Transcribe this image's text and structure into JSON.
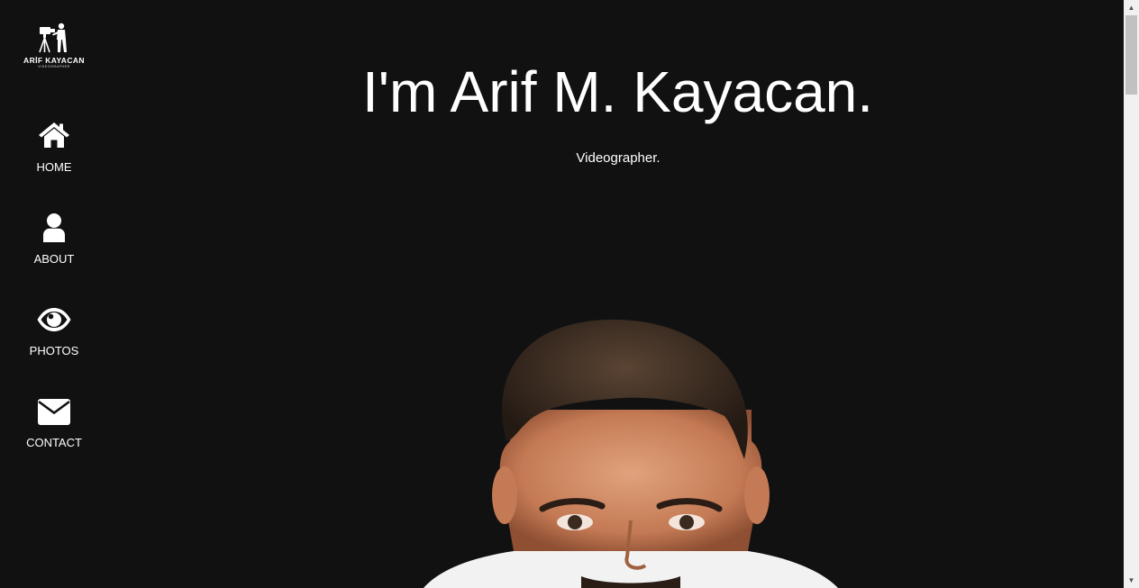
{
  "brand": {
    "name": "ARİF KAYACAN",
    "tagline": "VIDEOGRAPHER"
  },
  "nav": [
    {
      "label": "HOME",
      "icon": "home-icon"
    },
    {
      "label": "ABOUT",
      "icon": "user-icon"
    },
    {
      "label": "PHOTOS",
      "icon": "eye-icon"
    },
    {
      "label": "CONTACT",
      "icon": "envelope-icon"
    }
  ],
  "hero": {
    "title": "I'm Arif M. Kayacan.",
    "subtitle": "Videographer."
  },
  "colors": {
    "background": "#111111",
    "text": "#ffffff"
  }
}
